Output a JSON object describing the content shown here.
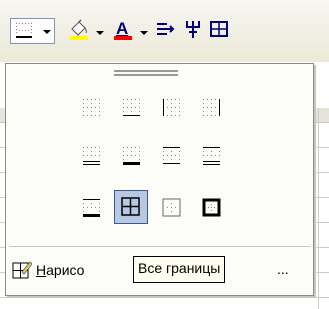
{
  "toolbar": {
    "buttons": [
      {
        "name": "borders-button",
        "icon": "borders-icon",
        "pressed": true
      },
      {
        "name": "fill-color-button",
        "icon": "fill-color-icon",
        "color": "#ffff00"
      },
      {
        "name": "font-color-button",
        "icon": "font-color-icon",
        "color": "#ff0000",
        "glyph": "A"
      },
      {
        "name": "text-direction-button",
        "icon": "text-direction-icon"
      },
      {
        "name": "merge-button",
        "icon": "merge-icon"
      },
      {
        "name": "table-button",
        "icon": "table-icon"
      }
    ]
  },
  "palette": {
    "border_options": [
      "no-border",
      "bottom-border",
      "left-border",
      "right-border",
      "bottom-double-border",
      "thick-bottom-border",
      "top-bottom-border",
      "top-double-bottom-border",
      "top-thick-bottom-border",
      "all-borders",
      "outside-borders",
      "thick-box-border"
    ],
    "selected_option": "all-borders",
    "draw_borders_label_underlined": "Н",
    "draw_borders_label_rest": "арисо",
    "tooltip": "Все границы",
    "ellipsis": "..."
  },
  "colors": {
    "selection": "#b8c8e3",
    "selection_border": "#3a5b8b",
    "fill_bar": "#ffff00",
    "font_bar": "#ff0000"
  }
}
